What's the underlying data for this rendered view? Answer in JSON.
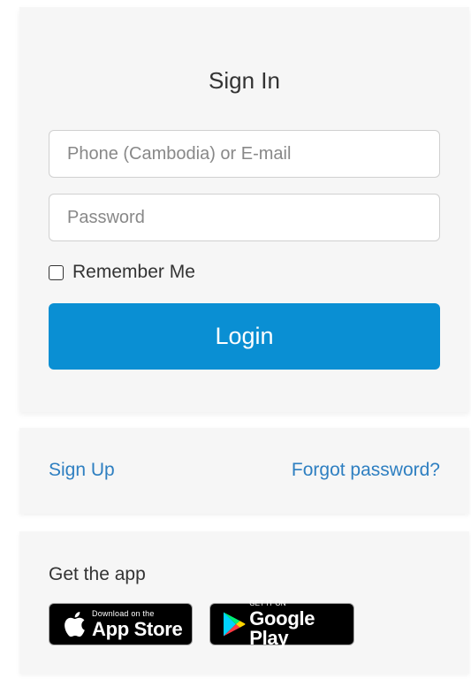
{
  "signin": {
    "title": "Sign In",
    "phone_placeholder": "Phone (Cambodia) or E-mail",
    "password_placeholder": "Password",
    "remember_label": "Remember Me",
    "remember_checked": false,
    "login_label": "Login",
    "accent_color": "#0a8fd3"
  },
  "links": {
    "signup_label": "Sign Up",
    "forgot_label": "Forgot password?",
    "link_color": "#2e7fc1"
  },
  "app": {
    "heading": "Get the app",
    "appstore": {
      "small_text": "Download on the",
      "big_text": "App Store",
      "icon": "apple-icon"
    },
    "googleplay": {
      "small_text": "GET IT ON",
      "big_text": "Google Play",
      "icon": "google-play-icon"
    }
  }
}
